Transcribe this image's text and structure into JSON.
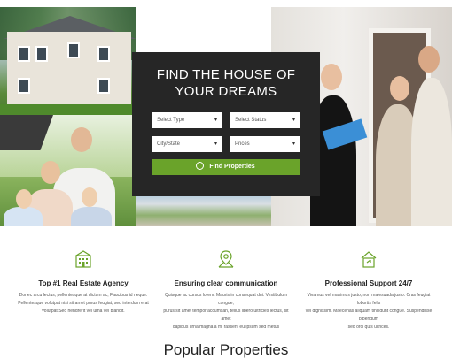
{
  "hero": {
    "title_line1": "FIND THE HOUSE OF",
    "title_line2": "YOUR DREAMS",
    "select_type": "Select Type",
    "select_status": "Select Status",
    "city_state": "City/State",
    "prices": "Prices",
    "find_button": "Find Properties"
  },
  "features": [
    {
      "icon": "building-icon",
      "title": "Top #1 Real Estate Agency",
      "description_lines": [
        "Donec arcu lectus, pellentesque at dictum ac, Faucibus id neque.",
        "Pellentesque volutpat nisi sit amet purus feugiat, sed interdum erat",
        "volutpat Sed hendrerit vel urna vel blandit."
      ]
    },
    {
      "icon": "map-pin-icon",
      "title": "Ensuring clear communication",
      "description_lines": [
        "Quisque ac cursus lorem. Mauris in consequat dui. Vestibulum congue,",
        "purus sit amet tempor accumsan, tellus libero ultricies lectus, sit amet",
        "dapibus urna magna a mi rassent eu ipsum sed metus"
      ]
    },
    {
      "icon": "home-icon",
      "title": "Professional Support 24/7",
      "description_lines": [
        "Vivamus vel maximus justo, non malesuada justo. Cras feugiat lobortis felis",
        "vel dignissim. Maecenas aliquam tincidunt congue. Suspendisse bibendum",
        "sed orci quis ultrices."
      ]
    }
  ],
  "section_title": "Popular Properties",
  "colors": {
    "accent": "#6aa32a",
    "panel": "#262626"
  }
}
